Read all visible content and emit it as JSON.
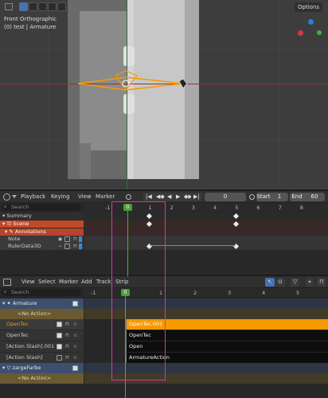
{
  "viewport": {
    "view_name": "Front Orthographic",
    "object_info": "(0) test | Armature",
    "options_label": "Options"
  },
  "dopesheet": {
    "header": {
      "playback": "Playback",
      "keying": "Keying",
      "view": "View",
      "marker": "Marker",
      "current_frame": "0",
      "start_label": "Start",
      "start_value": "1",
      "end_label": "End",
      "end_value": "60"
    },
    "search_placeholder": "Search",
    "frame_ticks": [
      "-1",
      "0",
      "1",
      "2",
      "3",
      "4",
      "5",
      "6",
      "7",
      "8"
    ],
    "current_frame_badge": "0",
    "channels": [
      {
        "label": "Summary"
      },
      {
        "label": "Scene"
      },
      {
        "label": "Annotations"
      },
      {
        "label": "Note"
      },
      {
        "label": "RulerData3D"
      }
    ]
  },
  "nla": {
    "header": {
      "view": "View",
      "select": "Select",
      "marker": "Marker",
      "add": "Add",
      "track": "Track",
      "strip": "Strip"
    },
    "search_placeholder": "Search",
    "frame_ticks": [
      "-1",
      "0",
      "1",
      "2",
      "3",
      "4",
      "5"
    ],
    "current_frame_badge": "0",
    "tracks": [
      {
        "label": "Armature"
      },
      {
        "label": "<No Action>"
      },
      {
        "label": "OpenTec"
      },
      {
        "label": "OpenTec"
      },
      {
        "label": "[Action Stash].001"
      },
      {
        "label": "[Action Stash]"
      },
      {
        "label": "zargeFarbe"
      },
      {
        "label": "<No Action>"
      }
    ],
    "strips": [
      {
        "label": "OpenTec.001"
      },
      {
        "label": "OpenTec"
      },
      {
        "label": "Open"
      },
      {
        "label": "ArmatureAction"
      }
    ]
  },
  "colors": {
    "accent": "#f59a00",
    "selection_box": "#d43aa8",
    "playhead": "#5aa83a",
    "scene_row": "#c04a2a",
    "object_row": "#3c4f6e"
  }
}
